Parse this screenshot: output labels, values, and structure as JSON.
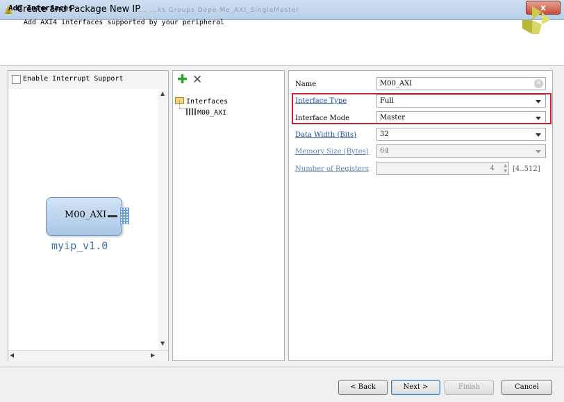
{
  "window": {
    "title": "Create and Package New IP",
    "ghost_text": "... ...ks Groups     Depe     Me_AXI_SingleMaster",
    "close_label": "x"
  },
  "header": {
    "title": "Add Interfaces",
    "subtitle": "Add AXI4 interfaces supported by your peripheral"
  },
  "left": {
    "enable_interrupt_label": "Enable Interrupt Support",
    "ip_port_label": "M00_AXI",
    "ip_name": "myip_v1.0"
  },
  "toolbar": {
    "add_icon": "plus-icon",
    "remove_icon": "x-icon"
  },
  "tree": {
    "root": "Interfaces",
    "child": "M00_AXI"
  },
  "form": {
    "name_label": "Name",
    "name_value": "M00_AXI",
    "interface_type_label": "Interface Type",
    "interface_type_value": "Full",
    "interface_mode_label": "Interface Mode",
    "interface_mode_value": "Master",
    "data_width_label": "Data Width (Bits)",
    "data_width_value": "32",
    "memory_size_label": "Memory Size (Bytes)",
    "memory_size_value": "64",
    "num_registers_label": "Number of Registers",
    "num_registers_value": "4",
    "num_registers_range": "[4..512]"
  },
  "buttons": {
    "back": "< Back",
    "next": "Next >",
    "finish": "Finish",
    "cancel": "Cancel"
  },
  "colors": {
    "highlight": "#c3212e",
    "link": "#1d4fa0"
  }
}
